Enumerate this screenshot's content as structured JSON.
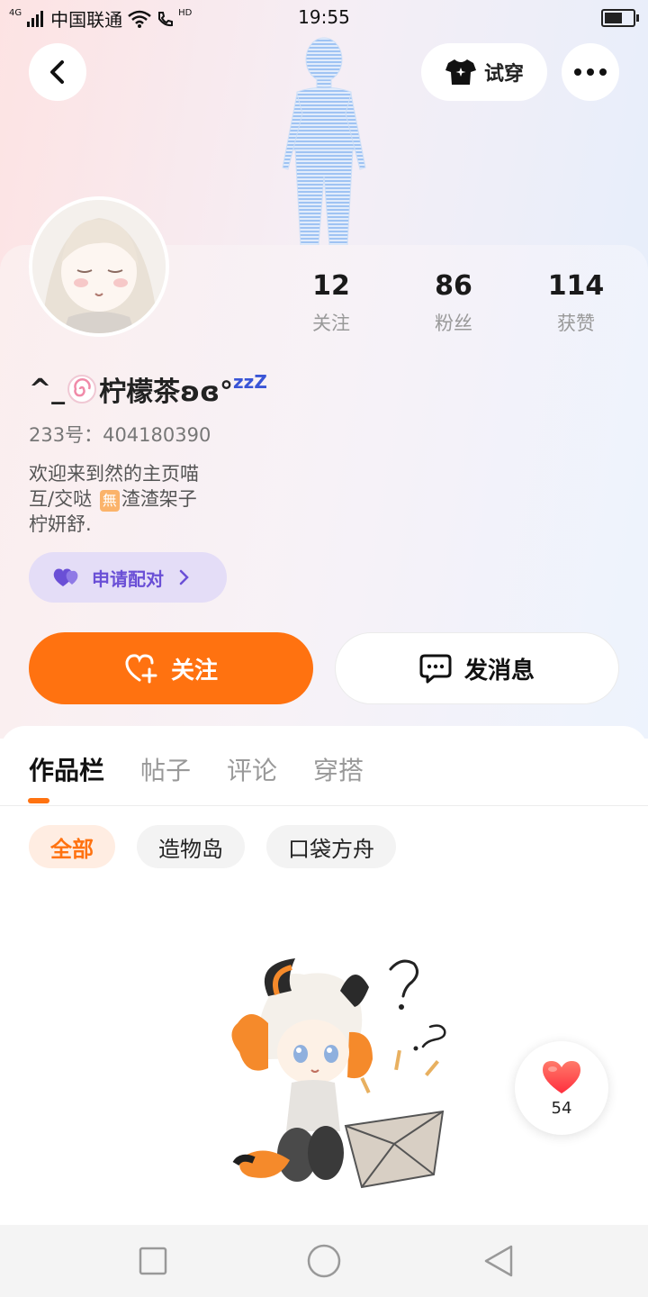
{
  "status_bar": {
    "network": "4G",
    "carrier": "中国联通",
    "hd": "HD",
    "time": "19:55",
    "battery_level": 0.7
  },
  "top_bar": {
    "tryon_label": "试穿"
  },
  "profile": {
    "stats": [
      {
        "value": "12",
        "label": "关注"
      },
      {
        "value": "86",
        "label": "粉丝"
      },
      {
        "value": "114",
        "label": "获赞"
      }
    ],
    "username_prefix": "^_",
    "username_main": "柠檬茶ʚɞ°",
    "username_suffix": "zzZ",
    "uid": "233号：404180390",
    "bio_lines": [
      "欢迎来到然的主页喵",
      "互/交哒",
      "渣渣架子",
      "柠妍舒."
    ],
    "bio_badge": "無",
    "pair_label": "申请配对",
    "follow_label": "关注",
    "message_label": "发消息"
  },
  "tabs": [
    "作品栏",
    "帖子",
    "评论",
    "穿搭"
  ],
  "active_tab": 0,
  "chips": [
    "全部",
    "造物岛",
    "口袋方舟"
  ],
  "active_chip": 0,
  "like_count": "54",
  "colors": {
    "accent": "#ff7210",
    "pair_purple": "#6a4fd6",
    "like_red": "#ff3b3b"
  }
}
